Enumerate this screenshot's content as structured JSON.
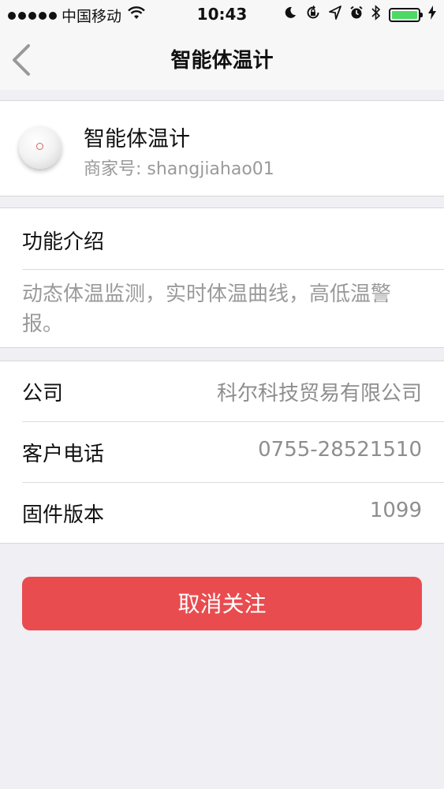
{
  "status_bar": {
    "carrier": "中国移动",
    "time": "10:43",
    "icons": [
      "signal-dots-icon",
      "wifi-icon",
      "moon-icon",
      "rotation-lock-icon",
      "location-icon",
      "alarm-icon",
      "bluetooth-icon",
      "battery-icon",
      "charging-icon"
    ],
    "battery_level": 1.0,
    "battery_color": "#4cd964"
  },
  "nav": {
    "title": "智能体温计",
    "back_icon": "chevron-left-icon"
  },
  "device": {
    "name": "智能体温计",
    "merchant": "商家号: shangjiahao01"
  },
  "intro": {
    "title": "功能介绍",
    "text": "动态体温监测，实时体温曲线，高低温警报。"
  },
  "info": {
    "rows": [
      {
        "label": "公司",
        "value": "科尔科技贸易有限公司"
      },
      {
        "label": "客户电话",
        "value": "0755-28521510"
      },
      {
        "label": "固件版本",
        "value": "1099"
      }
    ]
  },
  "action": {
    "unfollow_label": "取消关注",
    "color": "#e84c4f"
  }
}
